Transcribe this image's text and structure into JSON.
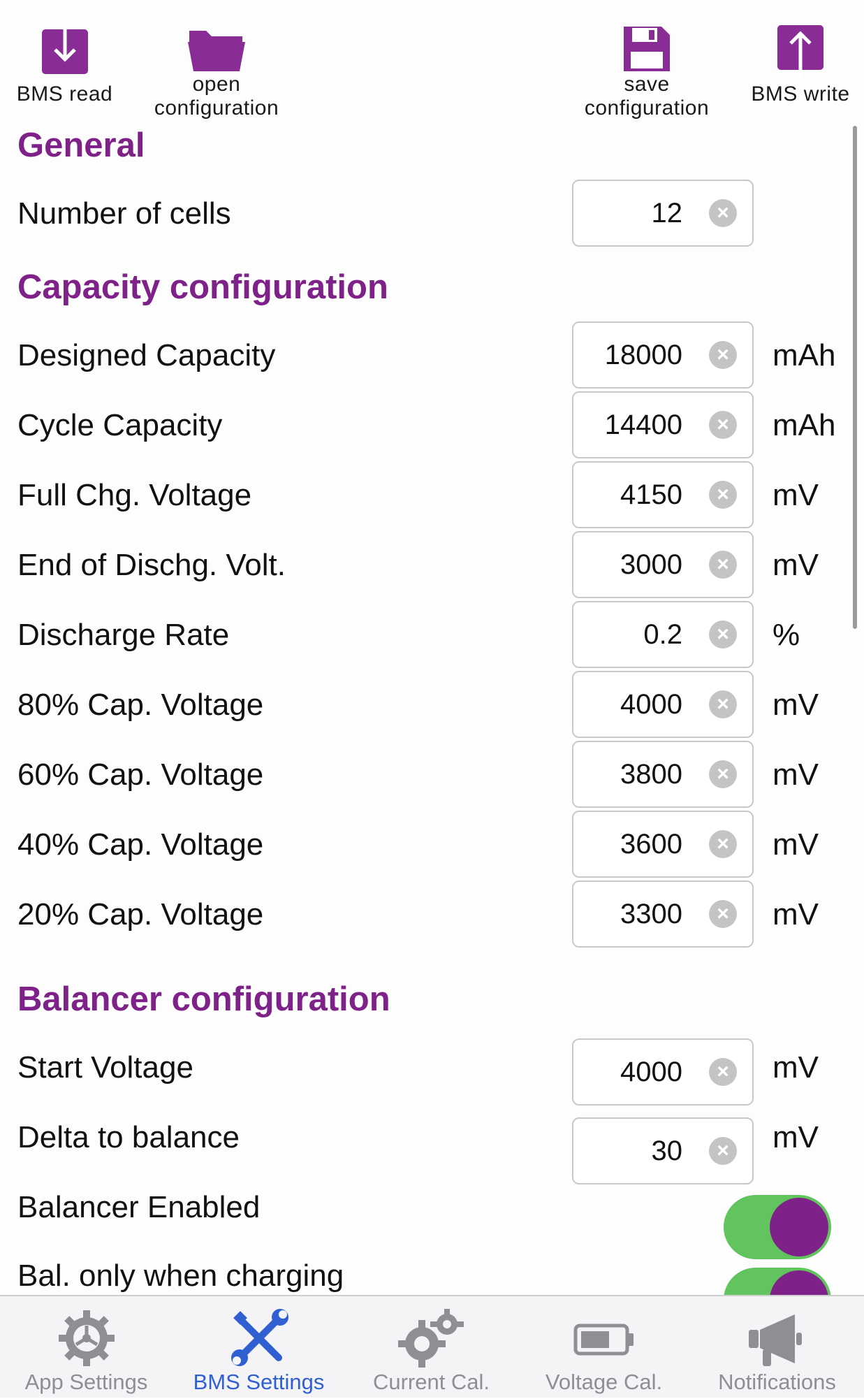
{
  "toolbar": {
    "bms_read": "BMS read",
    "open_configuration": "open\nconfiguration",
    "save_configuration": "save\nconfiguration",
    "bms_write": "BMS write"
  },
  "general": {
    "title": "General",
    "rows": [
      {
        "label": "Number of cells",
        "value": "12",
        "unit": ""
      }
    ]
  },
  "capacity": {
    "title": "Capacity configuration",
    "rows": [
      {
        "label": "Designed Capacity",
        "value": "18000",
        "unit": "mAh"
      },
      {
        "label": "Cycle Capacity",
        "value": "14400",
        "unit": "mAh"
      },
      {
        "label": "Full Chg. Voltage",
        "value": "4150",
        "unit": "mV"
      },
      {
        "label": "End of Dischg. Volt.",
        "value": "3000",
        "unit": "mV"
      },
      {
        "label": "Discharge Rate",
        "value": "0.2",
        "unit": "%"
      },
      {
        "label": "80% Cap. Voltage",
        "value": "4000",
        "unit": "mV"
      },
      {
        "label": "60% Cap. Voltage",
        "value": "3800",
        "unit": "mV"
      },
      {
        "label": "40% Cap. Voltage",
        "value": "3600",
        "unit": "mV"
      },
      {
        "label": "20% Cap. Voltage",
        "value": "3300",
        "unit": "mV"
      }
    ]
  },
  "balancer": {
    "title": "Balancer configuration",
    "rows": [
      {
        "label": "Start Voltage",
        "value": "4000",
        "unit": "mV"
      },
      {
        "label": "Delta to balance",
        "value": "30",
        "unit": "mV"
      }
    ],
    "toggles": [
      {
        "label": "Balancer Enabled",
        "on": true
      },
      {
        "label": "Bal. only when charging",
        "on": true
      }
    ]
  },
  "clear_glyph": "×",
  "colors": {
    "accent": "#7e2189",
    "toggle_on": "#62c45e",
    "tab_active": "#2f5fd1",
    "tab_inactive": "#8e8e93"
  },
  "tabs": [
    {
      "label": "App Settings",
      "icon": "gear-icon",
      "active": false
    },
    {
      "label": "BMS Settings",
      "icon": "wrench-screwdriver-icon",
      "active": true
    },
    {
      "label": "Current Cal.",
      "icon": "gears-icon",
      "active": false
    },
    {
      "label": "Voltage Cal.",
      "icon": "battery-icon",
      "active": false
    },
    {
      "label": "Notifications",
      "icon": "megaphone-icon",
      "active": false
    }
  ]
}
